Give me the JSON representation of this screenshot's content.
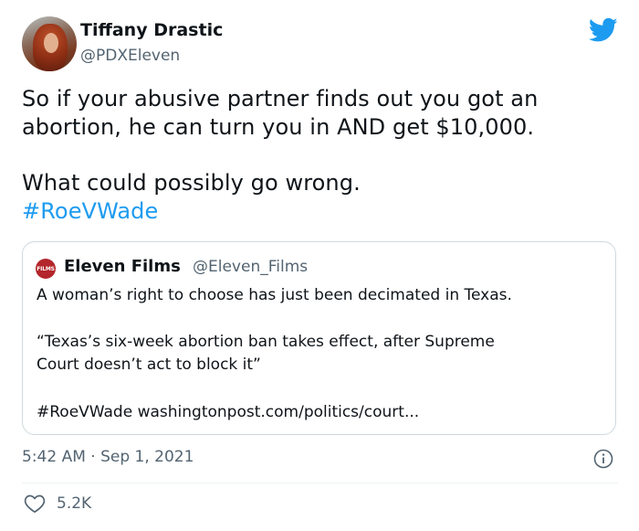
{
  "author": {
    "name": "Tiffany Drastic",
    "handle": "@PDXEleven"
  },
  "tweet": {
    "lines": [
      "So if your abusive partner finds out you got an",
      "abortion, he can turn you in AND get $10,000.",
      "What could possibly go wrong."
    ],
    "hashtag": "#RoeVWade"
  },
  "quoted": {
    "avatar_text": "FILMS",
    "name": "Eleven Films",
    "handle": "@Eleven_Films",
    "line1": "A woman’s right to choose has just been decimated in Texas.",
    "line2": "“Texas’s six-week abortion ban takes effect, after Supreme",
    "line3": "Court doesn’t act to block it”",
    "hashtag": "#RoeVWade",
    "link": "washingtonpost.com/politics/court..."
  },
  "meta": {
    "timestamp": "5:42 AM · Sep 1, 2021",
    "likes": "5.2K"
  },
  "colors": {
    "accent": "#1d9bf0",
    "secondary_text": "#536471",
    "border": "#cfd9de"
  },
  "icons": {
    "brand": "twitter-bird-icon",
    "info": "info-icon",
    "like": "heart-icon"
  }
}
